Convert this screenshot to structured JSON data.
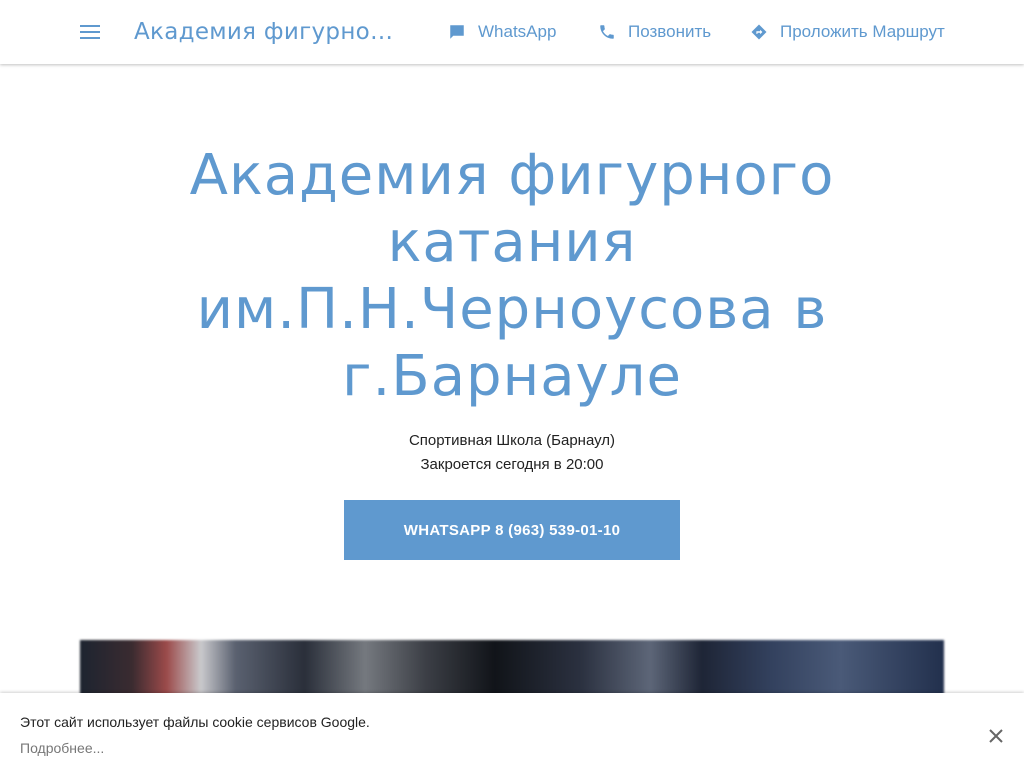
{
  "header": {
    "brand": "Академия фигурного...",
    "actions": {
      "whatsapp": "WhatsApp",
      "call": "Позвонить",
      "route": "Проложить Маршрут"
    }
  },
  "hero": {
    "title_lines": [
      "Академия фигурного",
      "катания",
      "им.П.Н.Черноусова в",
      "г.Барнауле"
    ],
    "category": "Спортивная Школа (Барнаул)",
    "hours": "Закроется сегодня в 20:00",
    "cta_label": "WHATSAPP 8 (963) 539-01-10"
  },
  "cookie_banner": {
    "text": "Этот сайт использует файлы cookie сервисов Google.",
    "link": "Подробнее..."
  },
  "icons": {
    "menu": "hamburger-menu-icon",
    "whatsapp": "chat-bubble-icon",
    "call": "phone-icon",
    "route": "directions-icon",
    "close": "close-icon"
  },
  "colors": {
    "accent": "#5f99cf",
    "text": "#222222",
    "muted": "#777777",
    "background": "#ffffff"
  }
}
